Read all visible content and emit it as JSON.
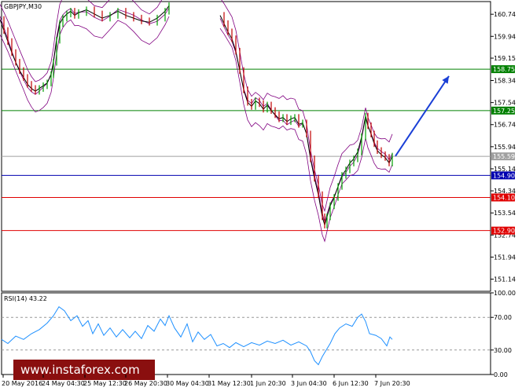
{
  "chart_data": {
    "type": "line",
    "title": "GBPJPY,M30",
    "price_axis": {
      "ylim": [
        150.7,
        161.2
      ],
      "ticks": [
        "160.74",
        "159.94",
        "159.15",
        "158.34",
        "157.54",
        "156.74",
        "155.94",
        "155.14",
        "154.34",
        "153.54",
        "152.74",
        "151.94",
        "151.14"
      ]
    },
    "levels": [
      {
        "value": 158.75,
        "label": "158.75",
        "color": "#008000"
      },
      {
        "value": 157.25,
        "label": "157.25",
        "color": "#008000"
      },
      {
        "value": 155.59,
        "label": "155.59",
        "color": "#a0a0a0"
      },
      {
        "value": 154.9,
        "label": "154.90",
        "color": "#0000b0"
      },
      {
        "value": 154.1,
        "label": "154.10",
        "color": "#e00000"
      },
      {
        "value": 152.9,
        "label": "152.90",
        "color": "#e00000"
      }
    ],
    "price_series": [
      [
        0,
        160.55
      ],
      [
        5,
        160.15
      ],
      [
        10,
        159.75
      ],
      [
        15,
        159.35
      ],
      [
        20,
        159.0
      ],
      [
        25,
        158.7
      ],
      [
        30,
        158.45
      ],
      [
        35,
        158.2
      ],
      [
        40,
        158.05
      ],
      [
        45,
        157.95
      ],
      [
        50,
        158.05
      ],
      [
        55,
        158.15
      ],
      [
        60,
        158.25
      ],
      [
        65,
        158.55
      ],
      [
        68,
        159.0
      ],
      [
        72,
        159.8
      ],
      [
        76,
        160.4
      ],
      [
        80,
        160.6
      ],
      [
        85,
        160.75
      ],
      [
        90,
        160.85
      ],
      [
        95,
        160.7
      ],
      [
        100,
        160.8
      ],
      [
        110,
        160.9
      ],
      [
        120,
        160.75
      ],
      [
        130,
        160.6
      ],
      [
        140,
        160.7
      ],
      [
        150,
        160.85
      ],
      [
        160,
        160.7
      ],
      [
        170,
        160.6
      ],
      [
        180,
        160.5
      ],
      [
        190,
        160.45
      ],
      [
        200,
        160.6
      ],
      [
        210,
        160.85
      ],
      [
        215,
        161.05
      ],
      [
        280,
        160.7
      ],
      [
        285,
        160.4
      ],
      [
        290,
        160.1
      ],
      [
        295,
        159.85
      ],
      [
        300,
        159.4
      ],
      [
        305,
        158.7
      ],
      [
        310,
        158.0
      ],
      [
        315,
        157.55
      ],
      [
        320,
        157.4
      ],
      [
        325,
        157.6
      ],
      [
        330,
        157.5
      ],
      [
        335,
        157.3
      ],
      [
        340,
        157.45
      ],
      [
        345,
        157.25
      ],
      [
        350,
        157.1
      ],
      [
        355,
        156.95
      ],
      [
        360,
        157.0
      ],
      [
        365,
        156.85
      ],
      [
        370,
        156.95
      ],
      [
        375,
        157.0
      ],
      [
        380,
        156.75
      ],
      [
        385,
        156.8
      ],
      [
        390,
        156.4
      ],
      [
        395,
        155.5
      ],
      [
        400,
        154.8
      ],
      [
        405,
        154.2
      ],
      [
        410,
        153.4
      ],
      [
        413,
        153.1
      ],
      [
        416,
        153.4
      ],
      [
        420,
        153.8
      ],
      [
        425,
        154.1
      ],
      [
        430,
        154.5
      ],
      [
        435,
        154.9
      ],
      [
        440,
        155.1
      ],
      [
        445,
        155.35
      ],
      [
        450,
        155.5
      ],
      [
        455,
        155.75
      ],
      [
        460,
        156.3
      ],
      [
        465,
        157.05
      ],
      [
        468,
        156.7
      ],
      [
        472,
        156.4
      ],
      [
        476,
        156.05
      ],
      [
        480,
        155.8
      ],
      [
        485,
        155.65
      ],
      [
        490,
        155.55
      ],
      [
        495,
        155.35
      ],
      [
        499,
        155.6
      ]
    ],
    "forecast_arrow": {
      "from_x": 503,
      "from_y": 155.6,
      "to_x": 571,
      "to_y": 158.5
    },
    "x_ticks": [
      "20 May 2016",
      "24 May 04:30",
      "25 May 12:30",
      "26 May 20:30",
      "30 May 04:30",
      "31 May 12:30",
      "1 Jun 20:30",
      "3 Jun 04:30",
      "6 Jun 12:30",
      "7 Jun 20:30"
    ],
    "rsi": {
      "label": "RSI(14) 43.22",
      "ylim": [
        0,
        100
      ],
      "ticks": [
        "100.00",
        "70.00",
        "30.00",
        "0.00"
      ],
      "levels": [
        70,
        30
      ],
      "series": [
        [
          2,
          43
        ],
        [
          10,
          38
        ],
        [
          20,
          47
        ],
        [
          30,
          43
        ],
        [
          40,
          50
        ],
        [
          50,
          55
        ],
        [
          60,
          63
        ],
        [
          68,
          72
        ],
        [
          75,
          83
        ],
        [
          82,
          78
        ],
        [
          90,
          66
        ],
        [
          98,
          72
        ],
        [
          105,
          59
        ],
        [
          112,
          66
        ],
        [
          118,
          50
        ],
        [
          125,
          62
        ],
        [
          132,
          48
        ],
        [
          140,
          57
        ],
        [
          148,
          46
        ],
        [
          156,
          55
        ],
        [
          165,
          45
        ],
        [
          172,
          53
        ],
        [
          180,
          44
        ],
        [
          188,
          60
        ],
        [
          196,
          53
        ],
        [
          204,
          68
        ],
        [
          210,
          60
        ],
        [
          215,
          72
        ],
        [
          222,
          57
        ],
        [
          230,
          46
        ],
        [
          238,
          62
        ],
        [
          245,
          40
        ],
        [
          252,
          52
        ],
        [
          260,
          43
        ],
        [
          268,
          49
        ],
        [
          276,
          35
        ],
        [
          284,
          38
        ],
        [
          292,
          33
        ],
        [
          300,
          39
        ],
        [
          310,
          34
        ],
        [
          320,
          39
        ],
        [
          330,
          36
        ],
        [
          340,
          41
        ],
        [
          350,
          38
        ],
        [
          360,
          42
        ],
        [
          370,
          36
        ],
        [
          380,
          40
        ],
        [
          390,
          35
        ],
        [
          395,
          28
        ],
        [
          400,
          17
        ],
        [
          405,
          12
        ],
        [
          410,
          22
        ],
        [
          415,
          30
        ],
        [
          420,
          38
        ],
        [
          426,
          50
        ],
        [
          432,
          57
        ],
        [
          440,
          62
        ],
        [
          448,
          59
        ],
        [
          455,
          70
        ],
        [
          460,
          74
        ],
        [
          465,
          65
        ],
        [
          470,
          50
        ],
        [
          478,
          48
        ],
        [
          485,
          44
        ],
        [
          492,
          35
        ],
        [
          496,
          46
        ],
        [
          499,
          43
        ]
      ]
    },
    "watermark": "www.instaforex.com"
  }
}
